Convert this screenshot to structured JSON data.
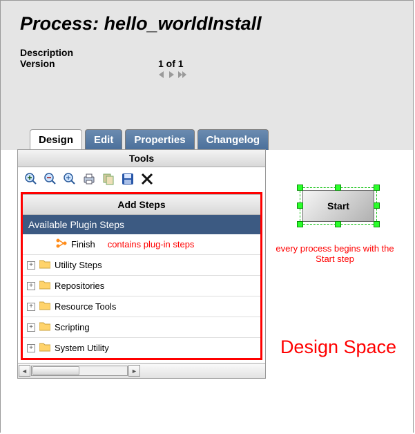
{
  "header": {
    "title": "Process: hello_worldInstall",
    "desc_label": "Description",
    "version_label": "Version",
    "version_value": "1 of 1"
  },
  "tabs": [
    "Design",
    "Edit",
    "Properties",
    "Changelog"
  ],
  "active_tab": 0,
  "tools_panel": {
    "title": "Tools",
    "toolbar": [
      "zoom-in",
      "zoom-out",
      "zoom-fit",
      "print",
      "copy",
      "save",
      "delete"
    ],
    "add_steps_title": "Add Steps",
    "available_header": "Available Plugin Steps",
    "finish_label": "Finish",
    "finish_note": "contains plug-in steps",
    "folders": [
      "Utility Steps",
      "Repositories",
      "Resource Tools",
      "Scripting",
      "System Utility"
    ]
  },
  "canvas": {
    "start_label": "Start",
    "start_caption": "every process begins with the Start step",
    "design_space_label": "Design Space"
  }
}
